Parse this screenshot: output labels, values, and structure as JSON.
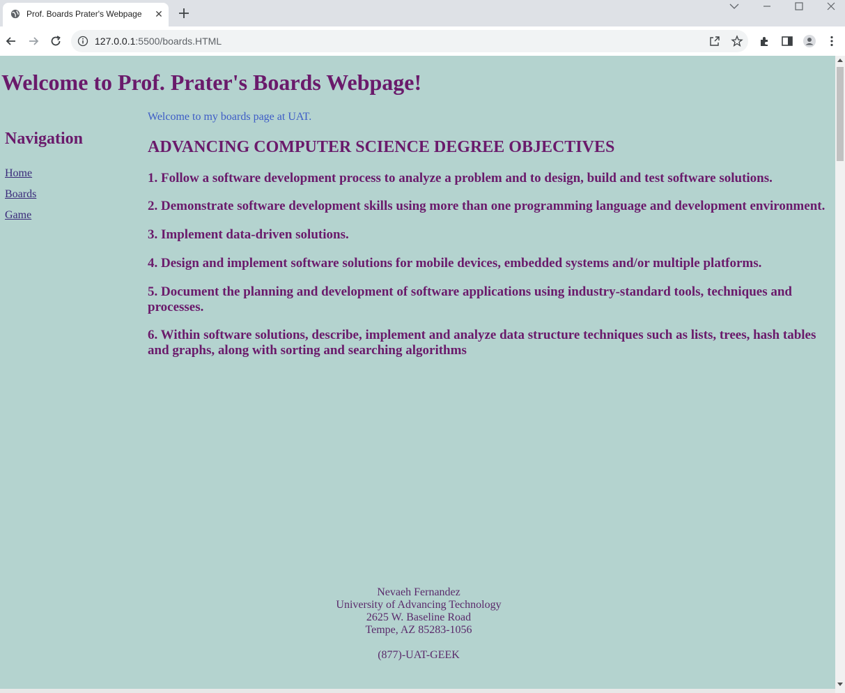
{
  "browser": {
    "tab_title": "Prof. Boards Prater's Webpage",
    "url_host": "127.0.0.1",
    "url_path": ":5500/boards.HTML"
  },
  "page": {
    "heading": "Welcome to Prof. Prater's Boards Webpage!",
    "nav_title": "Navigation",
    "nav_links": [
      "Home",
      "Boards",
      "Game"
    ],
    "intro": "Welcome to my boards page at UAT.",
    "objectives_title": "ADVANCING COMPUTER SCIENCE DEGREE OBJECTIVES",
    "objectives": [
      "1. Follow a software development process to analyze a problem and to design, build and test software solutions.",
      "2. Demonstrate software development skills using more than one programming language and development environment.",
      "3. Implement data-driven solutions.",
      "4. Design and implement software solutions for mobile devices, embedded systems and/or multiple platforms.",
      "5. Document the planning and development of software applications using industry-standard tools, techniques and processes.",
      "6. Within software solutions, describe, implement and analyze data structure techniques such as lists, trees, hash tables and graphs, along with sorting and searching algorithms"
    ],
    "footer": {
      "name": "Nevaeh Fernandez",
      "school": "University of Advancing Technology",
      "street": "2625 W. Baseline Road",
      "city": "Tempe, AZ 85283-1056",
      "phone": "(877)-UAT-GEEK"
    }
  },
  "colors": {
    "page_bg": "#b4d3cf",
    "heading": "#6a1a6b",
    "intro_text": "#3d5cc6"
  }
}
